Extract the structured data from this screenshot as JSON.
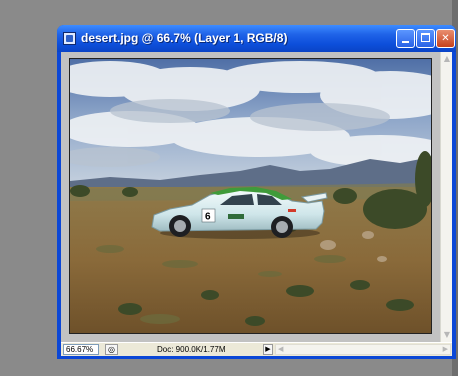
{
  "window": {
    "title": "desert.jpg @ 66.7% (Layer 1, RGB/8)",
    "app_icon": "photoshop-document-icon",
    "buttons": [
      "minimize",
      "maximize",
      "close"
    ]
  },
  "statusbar": {
    "zoom": "66.67%",
    "doc_info": "Doc: 900.0K/1.77M",
    "menu_arrow": "▶"
  },
  "colors": {
    "titlebar": "#0d4fdb",
    "workspace": "#8a8a8a",
    "canvas_background": "#c2c2c2",
    "close_button": "#d0512b"
  }
}
